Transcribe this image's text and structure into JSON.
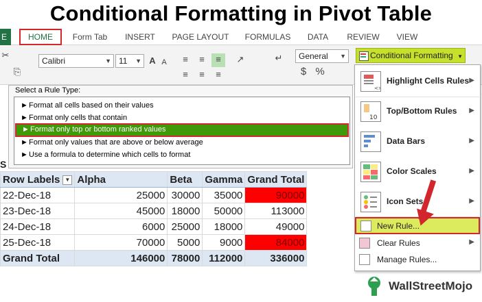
{
  "title": "Conditional Formatting in Pivot Table",
  "ribbon": {
    "tabs": [
      "HOME",
      "Form Tab",
      "INSERT",
      "PAGE LAYOUT",
      "FORMULAS",
      "DATA",
      "REVIEW",
      "VIEW"
    ],
    "file_tab_fragment": "E",
    "font_name": "Calibri",
    "font_size": "11",
    "number_format": "General",
    "currency_symbol": "$",
    "percent_symbol": "%",
    "conditional_formatting": "Conditional Formatting"
  },
  "dialog": {
    "label": "Select a Rule Type:",
    "rules": [
      "Format all cells based on their values",
      "Format only cells that contain",
      "Format only top or bottom ranked values",
      "Format only values that are above or below average",
      "Use a formula to determine which cells to format"
    ],
    "selected_index": 2
  },
  "pivot": {
    "sheet_tag": "S",
    "headers": [
      "Row Labels",
      "Alpha",
      "Beta",
      "Gamma",
      "Grand Total"
    ],
    "rows": [
      {
        "label": "22-Dec-18",
        "alpha": "25000",
        "beta": "30000",
        "gamma": "35000",
        "total": "90000",
        "highlight": true
      },
      {
        "label": "23-Dec-18",
        "alpha": "45000",
        "beta": "18000",
        "gamma": "50000",
        "total": "113000",
        "highlight": false
      },
      {
        "label": "24-Dec-18",
        "alpha": "6000",
        "beta": "25000",
        "gamma": "18000",
        "total": "49000",
        "highlight": false
      },
      {
        "label": "25-Dec-18",
        "alpha": "70000",
        "beta": "5000",
        "gamma": "9000",
        "total": "84000",
        "highlight": true
      }
    ],
    "grand_total": {
      "label": "Grand Total",
      "alpha": "146000",
      "beta": "78000",
      "gamma": "112000",
      "total": "336000"
    }
  },
  "menu": {
    "items": [
      {
        "label": "Highlight Cells Rules",
        "submenu": true
      },
      {
        "label": "Top/Bottom Rules",
        "submenu": true
      },
      {
        "label": "Data Bars",
        "submenu": true
      },
      {
        "label": "Color Scales",
        "submenu": true
      },
      {
        "label": "Icon Sets",
        "submenu": true
      }
    ],
    "topbottom_icon_number": "10",
    "new_rule": "New Rule...",
    "clear_rules": "Clear Rules",
    "manage_rules": "Manage Rules..."
  },
  "logo": {
    "text": "WallStreetMojo"
  },
  "colors": {
    "highlight_red": "#ff0000",
    "selected_green": "#3e9a08",
    "cf_button": "#c6e02c",
    "callout_red": "#d0262c"
  }
}
